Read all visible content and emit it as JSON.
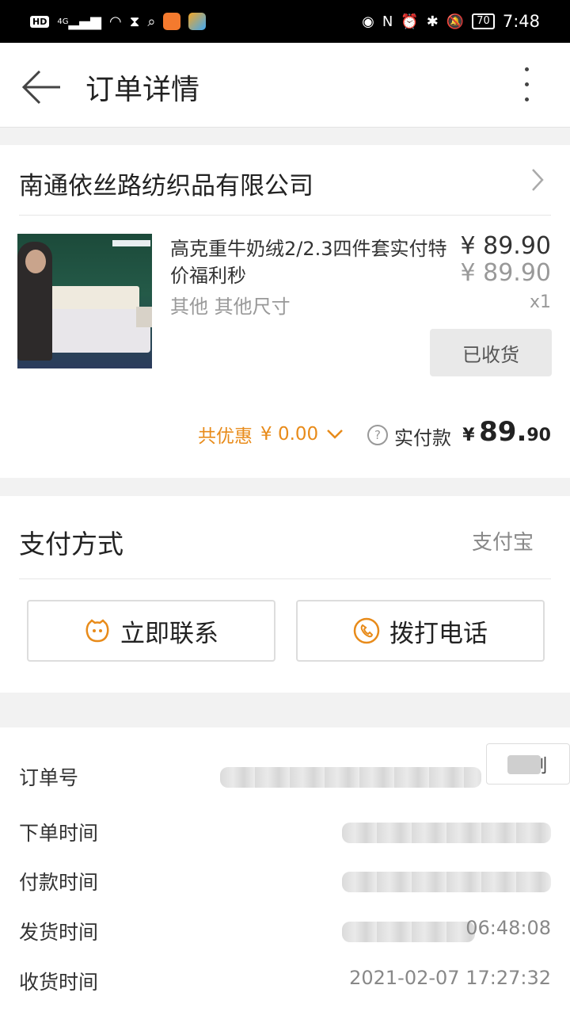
{
  "status_bar": {
    "network": "4G",
    "battery": "70",
    "time": "7:48"
  },
  "header": {
    "title": "订单详情"
  },
  "order": {
    "shop_name": "南通依丝路纺织品有限公司",
    "product": {
      "title": "高克重牛奶绒2/2.3四件套实付特价福利秒",
      "price_paid": "¥ 89.90",
      "price_original": "¥ 89.90",
      "spec": "其他 其他尺寸",
      "quantity": "x1",
      "status_button": "已收货"
    },
    "discount_label": "共优惠",
    "discount_value": "¥ 0.00",
    "paid_label": "实付款",
    "paid_currency": "¥",
    "paid_int": "89.",
    "paid_dec": "90"
  },
  "payment": {
    "label": "支付方式",
    "value": "支付宝"
  },
  "actions": {
    "contact_label": "立即联系",
    "call_label": "拨打电话"
  },
  "details": {
    "order_no_label": "订单号",
    "copy_label": "制",
    "order_time_label": "下单时间",
    "pay_time_label": "付款时间",
    "ship_time_label": "发货时间",
    "ship_time_partial": "06:48:08",
    "receive_time_label": "收货时间",
    "receive_time_value": "2021-02-07 17:27:32"
  },
  "colors": {
    "accent_orange": "#e88b1a",
    "background": "#f2f2f2"
  }
}
